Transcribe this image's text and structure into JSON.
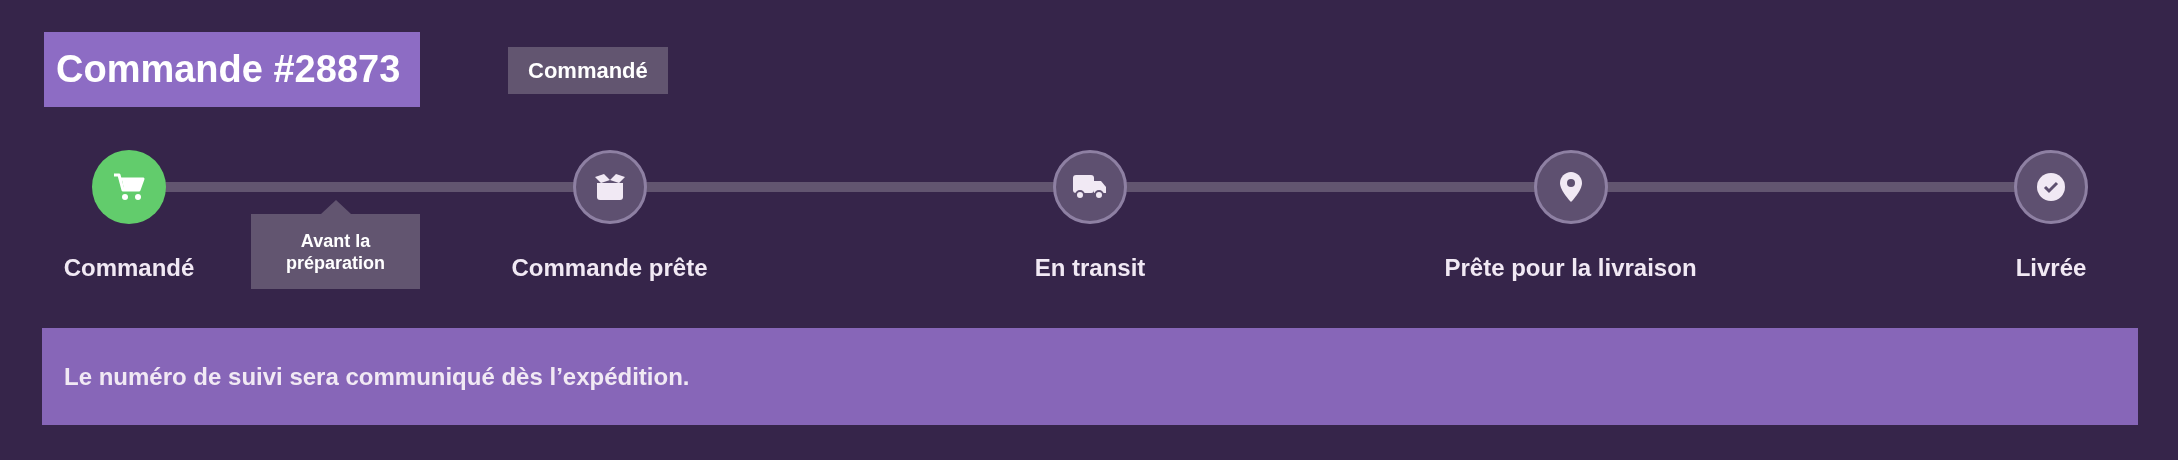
{
  "order": {
    "title": "Commande #28873",
    "status": "Commandé"
  },
  "steps": [
    {
      "label": "Commandé",
      "completed": true
    },
    {
      "label": "Commande prête",
      "completed": false
    },
    {
      "label": "En transit",
      "completed": false
    },
    {
      "label": "Prête pour la livraison",
      "completed": false
    },
    {
      "label": "Livrée",
      "completed": false
    }
  ],
  "tooltip": {
    "text": "Avant la préparation"
  },
  "banner": {
    "text": "Le numéro de suivi sera communiqué dès l’expédition."
  }
}
